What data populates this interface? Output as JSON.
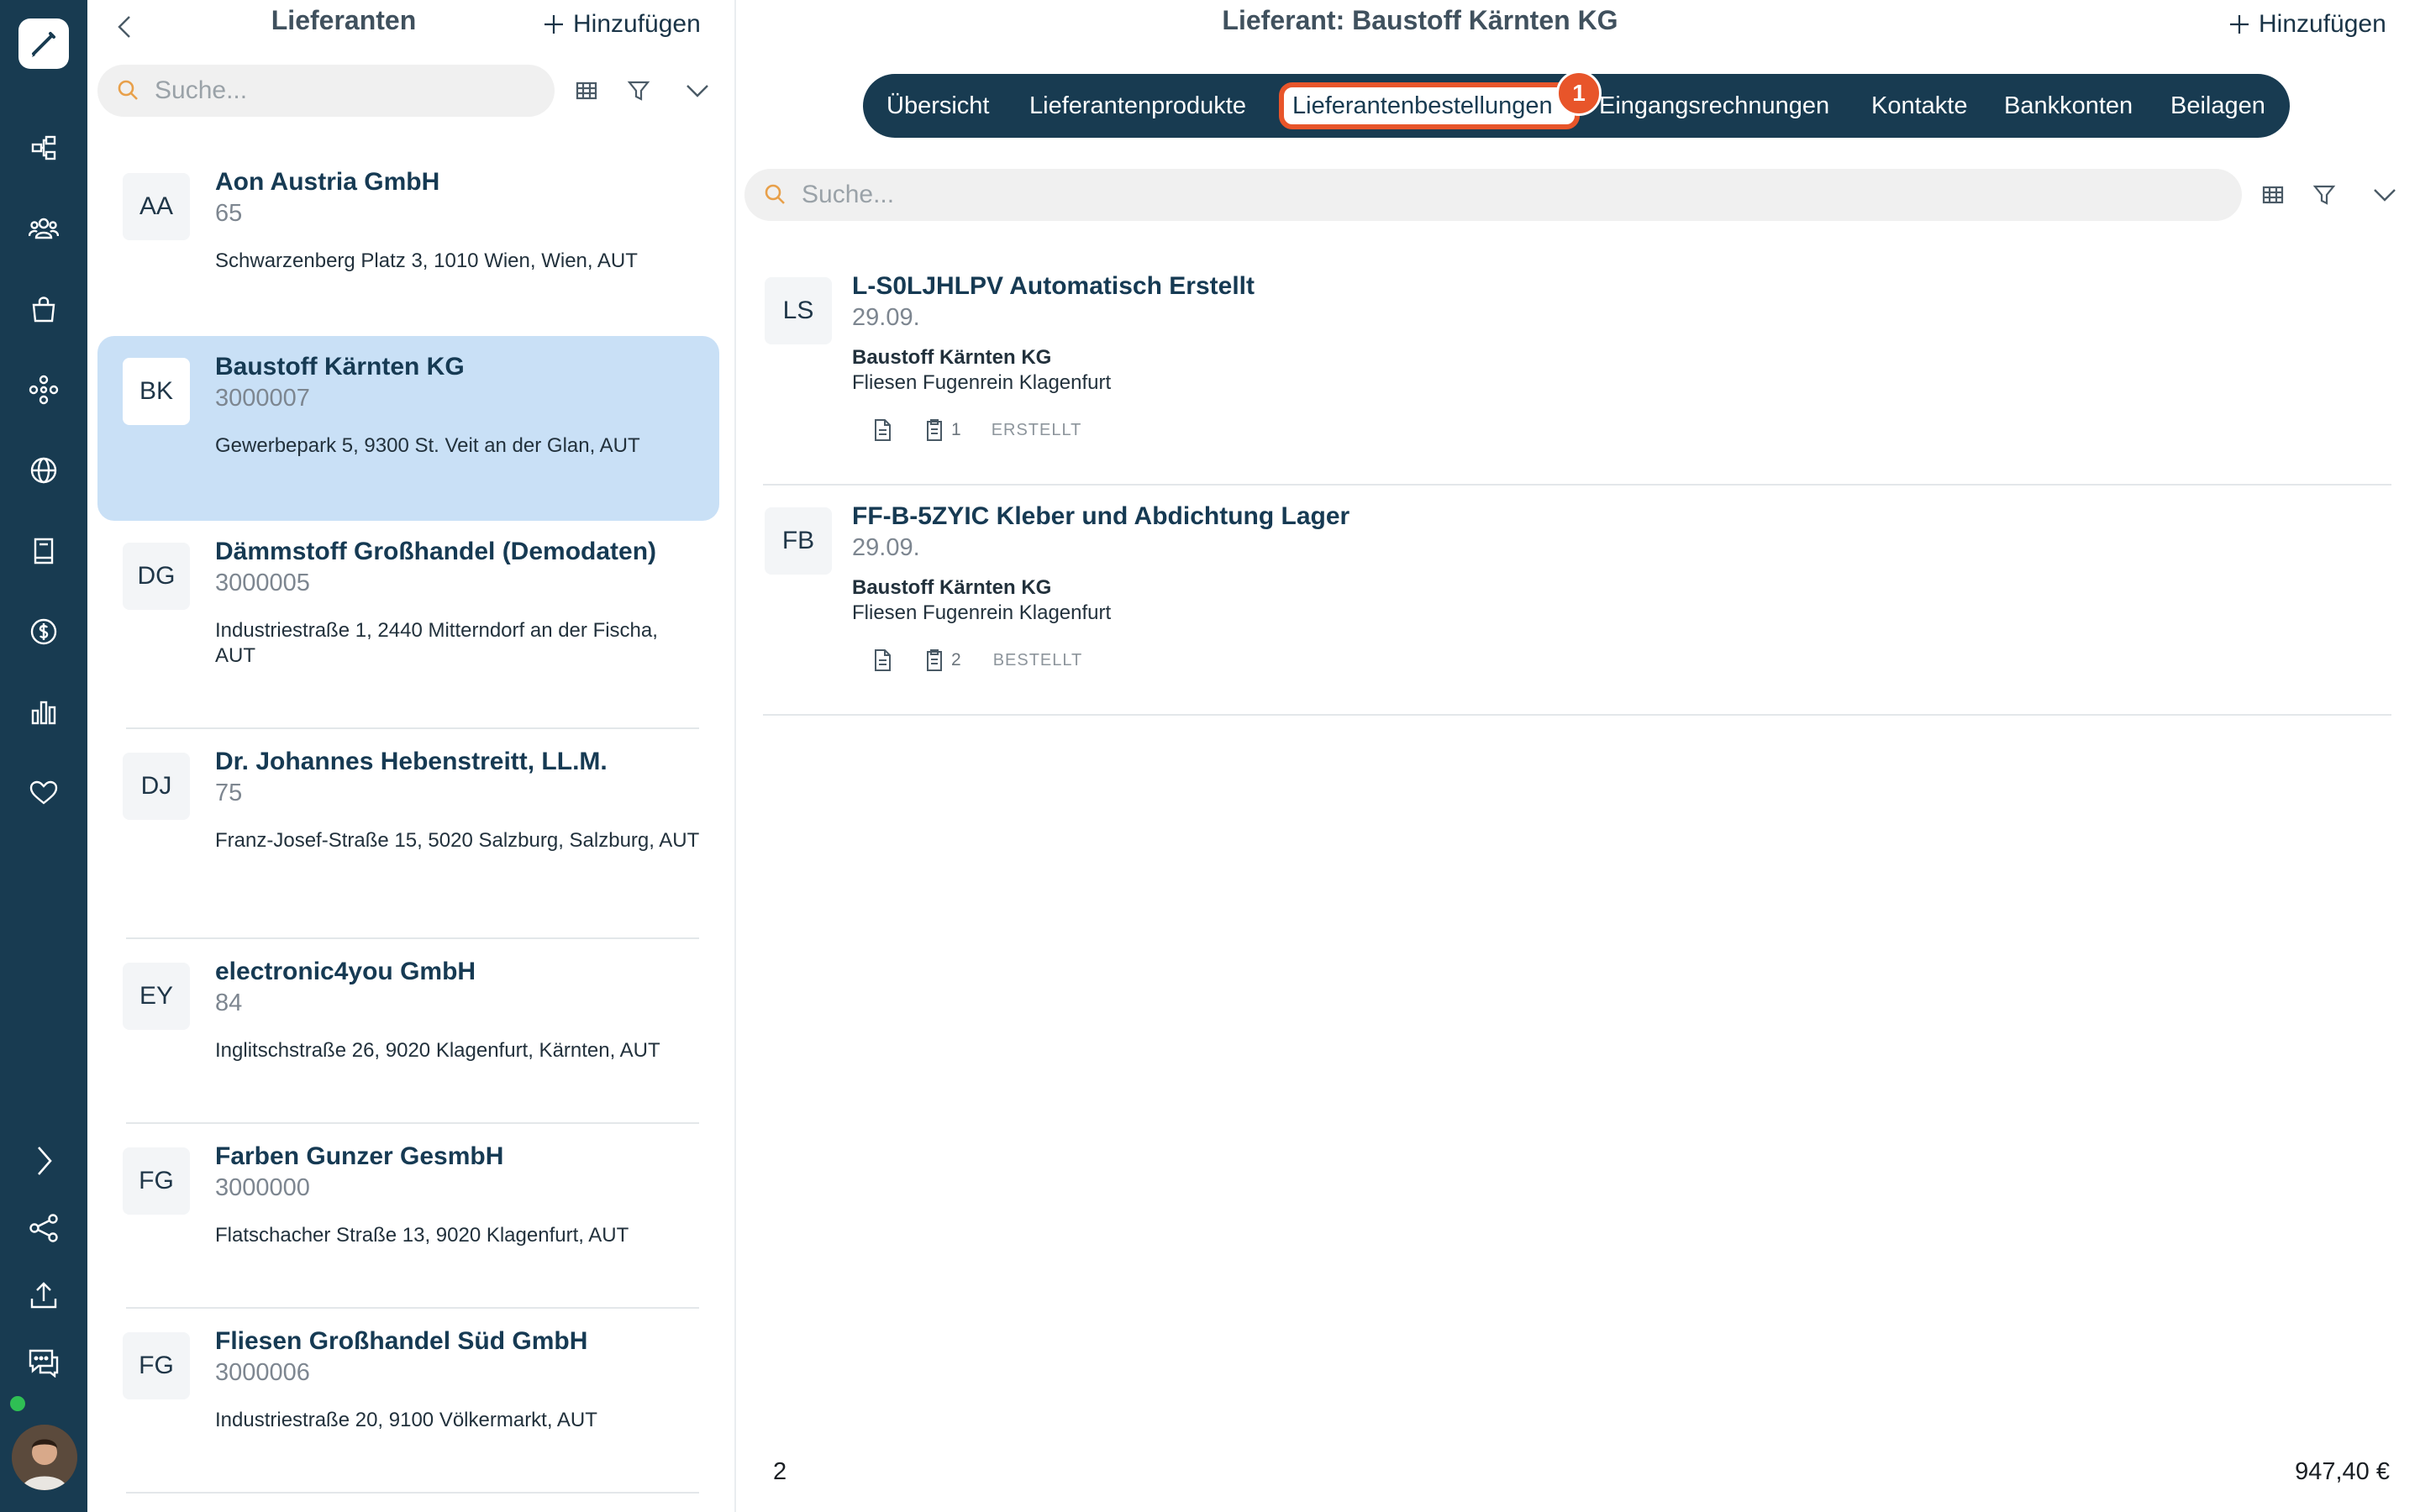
{
  "list": {
    "title": "Lieferanten",
    "add_label": "Hinzufügen",
    "search_placeholder": "Suche...",
    "suppliers": [
      {
        "initials": "AA",
        "name": "Aon Austria GmbH",
        "number": "65",
        "address": "Schwarzenberg Platz 3, 1010 Wien, Wien, AUT"
      },
      {
        "initials": "BK",
        "name": "Baustoff Kärnten KG",
        "number": "3000007",
        "address": "Gewerbepark 5, 9300 St. Veit an der Glan, AUT"
      },
      {
        "initials": "DG",
        "name": "Dämmstoff Großhandel (Demodaten)",
        "number": "3000005",
        "address": "Industriestraße 1, 2440 Mitterndorf an der Fischa, AUT"
      },
      {
        "initials": "DJ",
        "name": "Dr. Johannes Hebenstreitt, LL.M.",
        "number": "75",
        "address": "Franz-Josef-Straße 15, 5020 Salzburg, Salzburg, AUT"
      },
      {
        "initials": "EY",
        "name": "electronic4you GmbH",
        "number": "84",
        "address": "Inglitschstraße 26, 9020 Klagenfurt, Kärnten, AUT"
      },
      {
        "initials": "FG",
        "name": "Farben Gunzer GesmbH",
        "number": "3000000",
        "address": "Flatschacher Straße 13, 9020 Klagenfurt, AUT"
      },
      {
        "initials": "FG",
        "name": "Fliesen Großhandel Süd GmbH",
        "number": "3000006",
        "address": "Industriestraße 20, 9100 Völkermarkt, AUT"
      }
    ]
  },
  "detail": {
    "title": "Lieferant: Baustoff Kärnten KG",
    "add_label": "Hinzufügen",
    "tabs": [
      "Übersicht",
      "Lieferantenprodukte",
      "Lieferantenbestellungen",
      "Eingangsrechnungen",
      "Kontakte",
      "Bankkonten",
      "Beilagen"
    ],
    "active_tab": "Lieferantenbestellungen",
    "step_badge": "1",
    "search_placeholder": "Suche...",
    "orders": [
      {
        "initials": "LS",
        "title": "L-S0LJHLPV Automatisch Erstellt",
        "date": "29.09.",
        "supplier": "Baustoff Kärnten KG",
        "project": "Fliesen Fugenrein Klagenfurt",
        "item_count": "1",
        "status": "ERSTELLT"
      },
      {
        "initials": "FB",
        "title": "FF-B-5ZYIC Kleber und Abdichtung Lager",
        "date": "29.09.",
        "supplier": "Baustoff Kärnten KG",
        "project": "Fliesen Fugenrein Klagenfurt",
        "item_count": "2",
        "status": "BESTELLT"
      }
    ],
    "footer": {
      "count": "2",
      "total": "947,40 €"
    }
  },
  "colors": {
    "rail": "#183b51",
    "accent": "#e8552a",
    "selected": "#c9e0f6",
    "online": "#2fbf54"
  },
  "rail_icons": [
    "logo-icon",
    "workflow-icon",
    "users-icon",
    "shopping-bag-icon",
    "network-icon",
    "globe-icon",
    "book-icon",
    "dollar-icon",
    "bar-chart-icon",
    "heart-icon",
    "chevron-right-icon",
    "share-icon",
    "upload-icon",
    "chat-icon"
  ]
}
